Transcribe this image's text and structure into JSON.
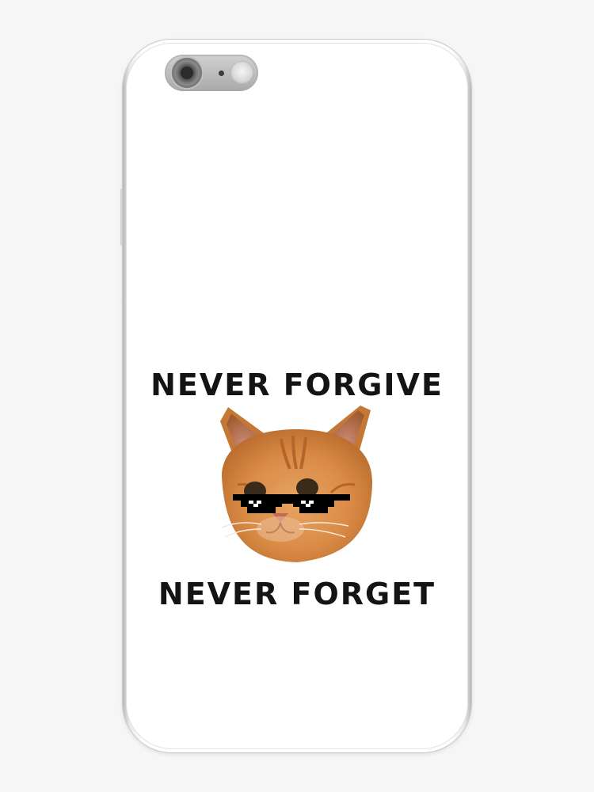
{
  "product": {
    "type": "iPhone skin / case print",
    "headline_top": "NEVER FORGIVE",
    "headline_bottom": "NEVER FORGET"
  },
  "illustration": {
    "subject": "orange-tabby-cat-with-pixel-sunglasses",
    "icon": "cat-face-icon",
    "accessory_icon": "pixel-sunglasses-icon"
  },
  "colors": {
    "text": "#141414",
    "case_background": "#ffffff",
    "frame": "#c8c8c8",
    "cat_fur": "#d98b45"
  }
}
